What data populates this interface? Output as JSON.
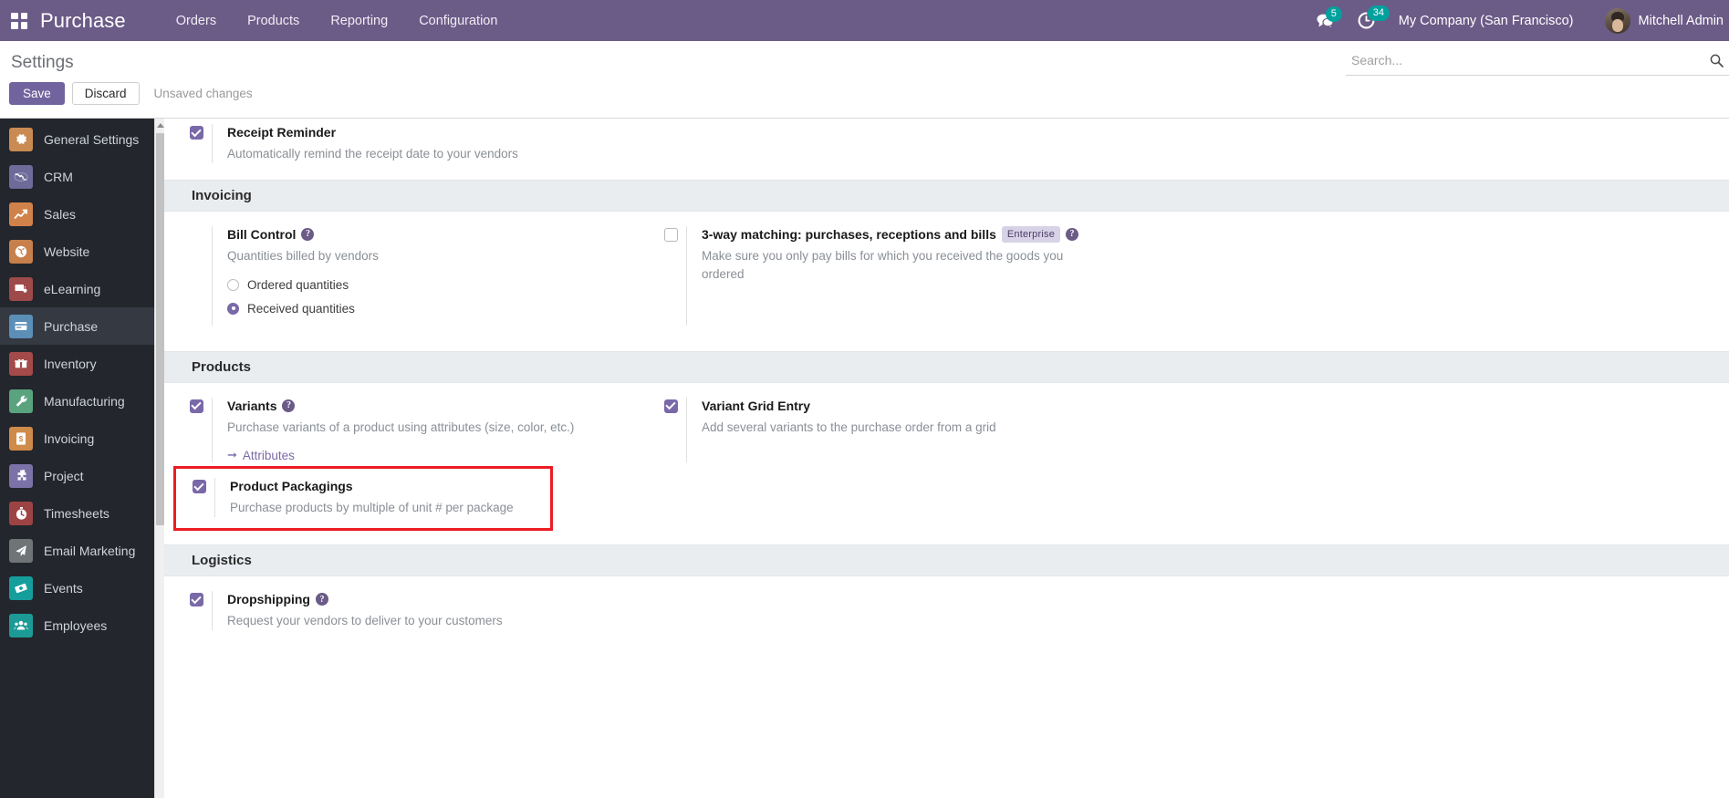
{
  "navbar": {
    "apps_icon": "apps-grid-icon",
    "brand": "Purchase",
    "menu": [
      {
        "label": "Orders"
      },
      {
        "label": "Products"
      },
      {
        "label": "Reporting"
      },
      {
        "label": "Configuration"
      }
    ],
    "messages_icon": "messages-icon",
    "messages_count": "5",
    "activity_icon": "clock-activity-icon",
    "activity_count": "34",
    "company": "My Company (San Francisco)",
    "user": "Mitchell Admin",
    "accent_color": "#6b5b87",
    "badge_color": "#00a09d"
  },
  "control_panel": {
    "title": "Settings",
    "save_label": "Save",
    "discard_label": "Discard",
    "unsaved_label": "Unsaved changes",
    "search_placeholder": "Search...",
    "search_value": ""
  },
  "sidebar": {
    "items": [
      {
        "label": "General Settings",
        "icon": "gear-icon",
        "color": "#c98b52",
        "active": false
      },
      {
        "label": "CRM",
        "icon": "handshake-icon",
        "color": "#6e6a99",
        "active": false
      },
      {
        "label": "Sales",
        "icon": "chart-line-icon",
        "color": "#d1824a",
        "active": false
      },
      {
        "label": "Website",
        "icon": "globe-icon",
        "color": "#c77f4b",
        "active": false
      },
      {
        "label": "eLearning",
        "icon": "presentation-icon",
        "color": "#9e4a4a",
        "active": false
      },
      {
        "label": "Purchase",
        "icon": "card-icon",
        "color": "#5b8fb8",
        "active": true
      },
      {
        "label": "Inventory",
        "icon": "box-icon",
        "color": "#a44a4a",
        "active": false
      },
      {
        "label": "Manufacturing",
        "icon": "wrench-icon",
        "color": "#5aa37f",
        "active": false
      },
      {
        "label": "Invoicing",
        "icon": "invoice-icon",
        "color": "#cf8b4a",
        "active": false
      },
      {
        "label": "Project",
        "icon": "puzzle-icon",
        "color": "#7b72a8",
        "active": false
      },
      {
        "label": "Timesheets",
        "icon": "stopwatch-icon",
        "color": "#9e4343",
        "active": false
      },
      {
        "label": "Email Marketing",
        "icon": "paper-plane-icon",
        "color": "#6f7577",
        "active": false
      },
      {
        "label": "Events",
        "icon": "ticket-icon",
        "color": "#159e9c",
        "active": false
      },
      {
        "label": "Employees",
        "icon": "people-icon",
        "color": "#1c9a96",
        "active": false
      }
    ]
  },
  "settings": {
    "receipt_reminder": {
      "title": "Receipt Reminder",
      "desc": "Automatically remind the receipt date to your vendors",
      "checked": true
    },
    "invoicing_section": "Invoicing",
    "bill_control": {
      "title": "Bill Control",
      "desc": "Quantities billed by vendors",
      "options": [
        {
          "label": "Ordered quantities",
          "selected": false
        },
        {
          "label": "Received quantities",
          "selected": true
        }
      ]
    },
    "three_way": {
      "title": "3-way matching: purchases, receptions and bills",
      "badge": "Enterprise",
      "desc": "Make sure you only pay bills for which you received the goods you ordered",
      "checked": false
    },
    "products_section": "Products",
    "variants": {
      "title": "Variants",
      "desc": "Purchase variants of a product using attributes (size, color, etc.)",
      "link": "Attributes",
      "checked": true
    },
    "variant_grid": {
      "title": "Variant Grid Entry",
      "desc": "Add several variants to the purchase order from a grid",
      "checked": true
    },
    "product_packagings": {
      "title": "Product Packagings",
      "desc": "Purchase products by multiple of unit # per package",
      "checked": true,
      "highlight_color": "#ec1c24"
    },
    "logistics_section": "Logistics",
    "dropshipping": {
      "title": "Dropshipping",
      "desc": "Request your vendors to deliver to your customers",
      "checked": true
    }
  }
}
